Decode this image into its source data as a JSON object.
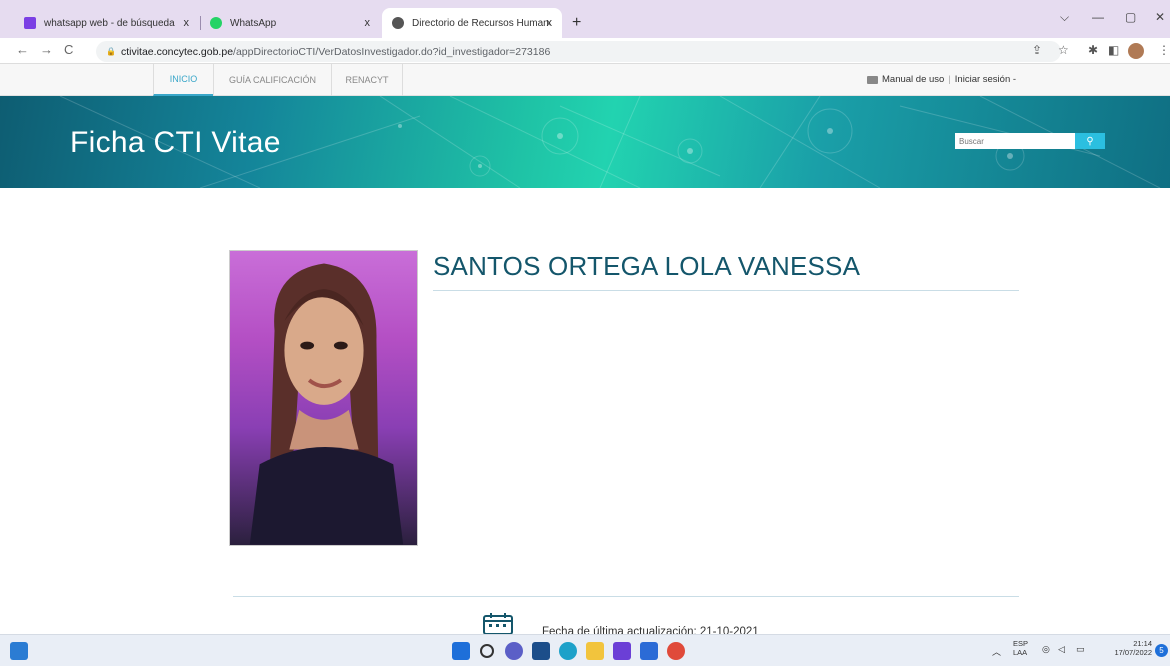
{
  "browser": {
    "tabs": [
      {
        "label": "whatsapp web - de búsqueda",
        "close": "x"
      },
      {
        "label": "WhatsApp",
        "close": "x"
      },
      {
        "label": "Directorio de Recursos Humanos",
        "close": "x"
      }
    ],
    "new_tab": "+",
    "url_domain": "ctivitae.concytec.gob.pe",
    "url_path": "/appDirectorioCTI/VerDatosInvestigador.do?id_investigador=273186"
  },
  "site_nav": {
    "items": [
      "INICIO",
      "GUÍA CALIFICACIÓN",
      "RENACYT"
    ],
    "manual": "Manual de uso",
    "login": "Iniciar sesión -"
  },
  "banner": {
    "title": "Ficha CTI Vitae",
    "search_placeholder": "Buscar"
  },
  "profile": {
    "name": "SANTOS ORTEGA LOLA VANESSA",
    "update_text": "Fecha de última actualización: 21-10-2021"
  },
  "taskbar": {
    "lang": "ESP",
    "layout": "LAA",
    "time": "21:14",
    "date": "17/07/2022",
    "notification": "5"
  },
  "colors": {
    "accent": "#3aa7c9",
    "name_color": "#14566b",
    "tab_bar": "#e6dcf0"
  }
}
